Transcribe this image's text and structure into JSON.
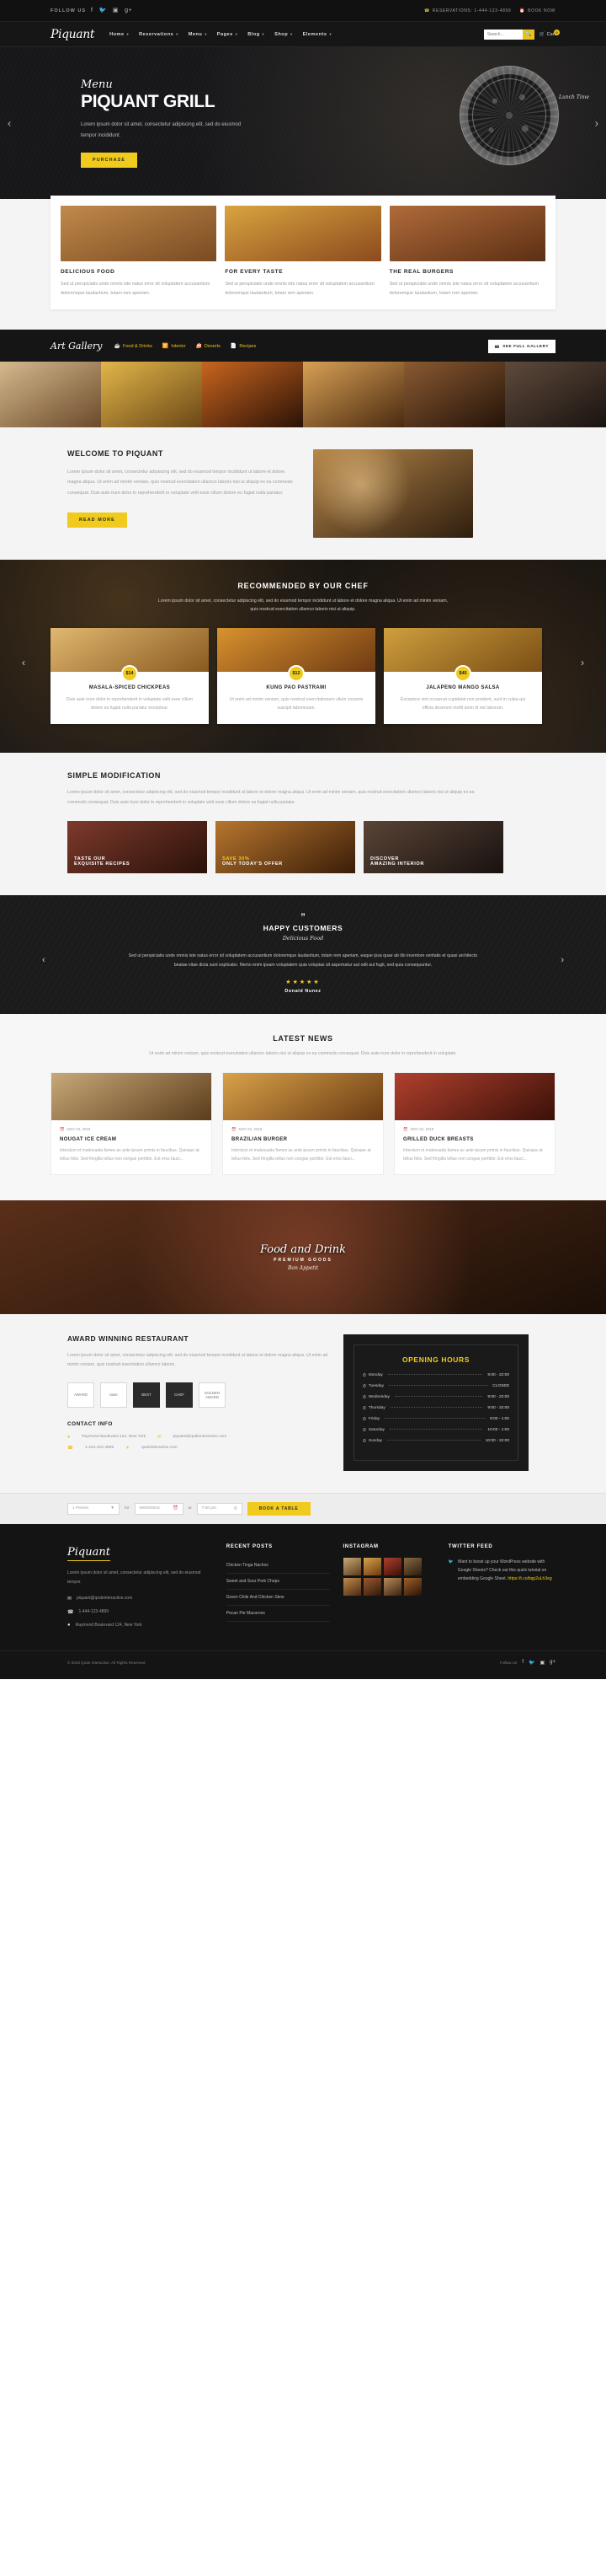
{
  "topbar": {
    "follow_label": "FOLLOW US",
    "socials": [
      "facebook-icon",
      "twitter-icon",
      "instagram-icon",
      "google-plus-icon"
    ],
    "links": [
      {
        "label": "RESERVATIONS: 1-444-123-4899",
        "icon": "phone-icon"
      },
      {
        "label": "BOOK NOW",
        "icon": "calendar-icon"
      }
    ]
  },
  "nav": {
    "logo": "Piquant",
    "items": [
      {
        "label": "Home",
        "caret": true,
        "active": false
      },
      {
        "label": "Reservations",
        "caret": true,
        "active": false
      },
      {
        "label": "Menu",
        "caret": true,
        "active": false
      },
      {
        "label": "Pages",
        "caret": true,
        "active": false
      },
      {
        "label": "Blog",
        "caret": true,
        "active": false
      },
      {
        "label": "Shop",
        "caret": true,
        "active": false
      },
      {
        "label": "Elements",
        "caret": true,
        "active": false
      }
    ],
    "search_placeholder": "Search...",
    "search_icon": "search-icon",
    "cart_label": "Cart",
    "cart_count": "0"
  },
  "hero": {
    "script": "Menu",
    "title": "PIQUANT GRILL",
    "text": "Lorem ipsum dolor sit amet, consectetur adipiscing elit, sed do eiusmod tempor incididunt.",
    "button": "PURCHASE",
    "lunch_label": "Lunch Time",
    "prev_icon": "chevron-left-icon",
    "next_icon": "chevron-right-icon"
  },
  "features": [
    {
      "title": "DELICIOUS FOOD",
      "text": "Sed ut perspiciatis unde omnis iste natus error sit voluptatem accusantium doloremque laudantium, totam rem aperiam."
    },
    {
      "title": "FOR EVERY TASTE",
      "text": "Sed ut perspiciatis unde omnis iste natus error sit voluptatem accusantium doloremque laudantium, totam rem aperiam."
    },
    {
      "title": "THE REAL BURGERS",
      "text": "Sed ut perspiciatis unde omnis iste natus error sit voluptatem accusantium doloremque laudantium, totam rem aperiam."
    }
  ],
  "gallery": {
    "title": "Art Gallery",
    "tabs": [
      {
        "label": "Food & Drinks",
        "icon": "cup-icon"
      },
      {
        "label": "Interior",
        "icon": "chair-icon"
      },
      {
        "label": "Deserts",
        "icon": "cake-icon"
      },
      {
        "label": "Recipes",
        "icon": "file-icon"
      }
    ],
    "button": "SEE FULL GALLERY",
    "button_icon": "camera-icon"
  },
  "welcome": {
    "title": "WELCOME TO PIQUANT",
    "p1": "Lorem ipsum dolor sit amet, consectetur adipiscing elit, sed do eiusmod tempor incididunt ut labore et dolore magna aliqua. Ut enim ad minim veniam, quis nostrud exercitation ullamco laboris nisi ut aliquip ex ea commodo consequat. Duis aute irure dolor in reprehenderit in voluptate velit esse cillum dolore eu fugiat nulla pariatur.",
    "button": "READ MORE"
  },
  "chef": {
    "title": "RECOMMENDED BY OUR CHEF",
    "text": "Lorem ipsum dolor sit amet, consectetur adipiscing elit, sed do eiusmod tempor incididunt ut labore et dolore magna aliqua. Ut enim ad minim veniam, quis nostrud exercitation ullamco laboris nisi ut aliquip.",
    "prev_icon": "chevron-left-icon",
    "next_icon": "chevron-right-icon",
    "dishes": [
      {
        "name": "MASALA-SPICED CHICKPEAS",
        "price": "$14",
        "text": "Duis aute irure dolor in reprehenderit in voluptate velit esse cillum dolore eu fugiat nulla pariatur excepteur."
      },
      {
        "name": "KUNG PAO PASTRAMI",
        "price": "$12",
        "text": "Ut enim ad minim veniam, quis nostrud exercitationem ullam corporis suscipit laboriosam."
      },
      {
        "name": "JALAPENO MANGO SALSA",
        "price": "$45",
        "text": "Excepteur sint occaecat cupidatat non proident, sunt in culpa qui officia deserunt mollit anim id est laborum."
      }
    ]
  },
  "simple": {
    "title": "SIMPLE MODIFICATION",
    "text": "Lorem ipsum dolor sit amet, consectetur adipiscing elit, sed do eiusmod tempor incididunt ut labore et dolore magna aliqua. Ut enim ad minim veniam, quis nostrud exercitation ullamco laboris nisi ut aliquip ex ea commodo consequat. Duis aute irure dolor in reprehenderit in voluptate velit esse cillum dolore eu fugiat nulla pariatur.",
    "promos": [
      {
        "line1": "TASTE OUR",
        "line2": "EXQUISITE RECIPES"
      },
      {
        "line1": "SAVE 30%",
        "line2": "ONLY TODAY'S OFFER"
      },
      {
        "line1": "DISCOVER",
        "line2": "AMAZING INTERIOR"
      }
    ]
  },
  "testimonial": {
    "quote_mark": "”",
    "title": "HAPPY CUSTOMERS",
    "subtitle": "Delicious Food",
    "text": "Sed ut perspiciatis unde omnis iste natus error sit voluptatem accusantium doloremque laudantium, totam rem aperiam, eaque ipsa quae ab illo inventore veritatis et quasi architecto beatae vitae dicta sunt explicabo. Nemo enim ipsam voluptatem quia voluptas sit aspernatur aut odit aut fugit, sed quia consequuntur.",
    "stars": "★★★★★",
    "author": "Donald Nunez",
    "prev_icon": "chevron-left-icon",
    "next_icon": "chevron-right-icon"
  },
  "news": {
    "title": "LATEST NEWS",
    "lead": "Ut enim ad minim veniam, quis nostrud exercitation ullamco laboris nisi ut aliquip ex ea commodo consequat. Duis aute irure dolor in reprehenderit in voluptate.",
    "posts": [
      {
        "date": "NOV 04, 2018",
        "date_icon": "calendar-icon",
        "title": "NOUGAT ICE CREAM",
        "text": "Interdum et malesuada fames ac ante ipsum primis in faucibus. Quisque at tellus felis. Sed fringilla tellus non congue porttitor. Est eros fauci..."
      },
      {
        "date": "NOV 04, 2018",
        "date_icon": "calendar-icon",
        "title": "BRAZILIAN BURGER",
        "text": "Interdum et malesuada fames ac ante ipsum primis in faucibus. Quisque at tellus felis. Sed fringilla tellus non congue porttitor. Est eros fauci..."
      },
      {
        "date": "NOV 04, 2018",
        "date_icon": "calendar-icon",
        "title": "GRILLED DUCK BREASTS",
        "text": "Interdum et malesuada fames ac ante ipsum primis in faucibus. Quisque at tellus felis. Sed fringilla tellus non congue porttitor. Est eros fauci..."
      }
    ]
  },
  "banner": {
    "title": "Food and Drink",
    "subtitle": "PREMIUM GOODS",
    "tagline": "Bon Appetit"
  },
  "award": {
    "title": "AWARD WINNING RESTAURANT",
    "text": "Lorem ipsum dolor sit amet, consectetur adipiscing elit, sed do eiusmod tempor incididunt ut labore et dolore magna aliqua. Ut enim ad minim veniam, quis nostrud exercitation ullamco laboris.",
    "badges": [
      "AWARD",
      "taste",
      "BEST",
      "CHEF",
      "GOLDEN AWARD"
    ],
    "contact_title": "CONTACT INFO",
    "contacts": [
      {
        "icon": "map-pin-icon",
        "label": "Raymond Boulevard 124, New York"
      },
      {
        "icon": "phone-icon",
        "label": "1-444-123-4899"
      },
      {
        "icon": "envelope-icon",
        "label": "piquant@qodeinteractive.com"
      }
    ],
    "contacts2": [
      {
        "icon": "envelope-icon",
        "label": "piquant@qodeinteractive.com"
      },
      {
        "icon": "globe-icon",
        "label": "qodeinteractive.com"
      }
    ]
  },
  "hours": {
    "title_1": "OPENING",
    "title_2": "HOURS",
    "rows": [
      {
        "day": "Monday",
        "time": "9:00 - 22:00"
      },
      {
        "day": "Tuesday",
        "time": "CLOSED"
      },
      {
        "day": "Wednesday",
        "time": "9:00 - 22:00"
      },
      {
        "day": "Thursday",
        "time": "9:00 - 22:00"
      },
      {
        "day": "Friday",
        "time": "9:00 - 1:00"
      },
      {
        "day": "Saturday",
        "time": "10:00 - 1:00"
      },
      {
        "day": "Sunday",
        "time": "10:00 - 22:00"
      }
    ],
    "clock_icon": "clock-icon"
  },
  "reservation": {
    "person_value": "1 Person",
    "for_label": "for",
    "date_value": "09/30/2023",
    "at_label": "at",
    "time_value": "7:00 pm",
    "button": "BOOK A TABLE",
    "calendar_icon": "calendar-icon",
    "clock_icon": "clock-icon",
    "caret_icon": "chevron-down-icon"
  },
  "footer": {
    "logo": "Piquant",
    "about": "Lorem ipsum dolor sit amet, consectetur adipiscing elit, sed do eiusmod tempor.",
    "email": "piquant@qodeinteractive.com",
    "phone": "1-444-123-4899",
    "address": "Raymond Boulevard 124, New York",
    "email_icon": "envelope-icon",
    "phone_icon": "phone-icon",
    "address_icon": "map-pin-icon",
    "recent_title": "RECENT POSTS",
    "recent": [
      "Chicken Tinga Nachos",
      "Sweet and Sour Pork Chops",
      "Green Chile And Chicken Stew",
      "Pecan Pie Macarons"
    ],
    "instagram_title": "INSTAGRAM",
    "twitter_title": "TWITTER FEED",
    "tweets": [
      {
        "icon": "twitter-icon",
        "text": "Want to boost up your WordPress website with Google Sheets? Check out this quick tutorial on embedding Google Sheet.",
        "link": "https://t.co/bqp2uLh3eg"
      }
    ],
    "copyright": "© 2018 Qode Interactive, All Rights Reserved",
    "follow_label": "Follow Us",
    "socials": [
      "facebook-icon",
      "twitter-icon",
      "instagram-icon",
      "google-plus-icon"
    ]
  }
}
